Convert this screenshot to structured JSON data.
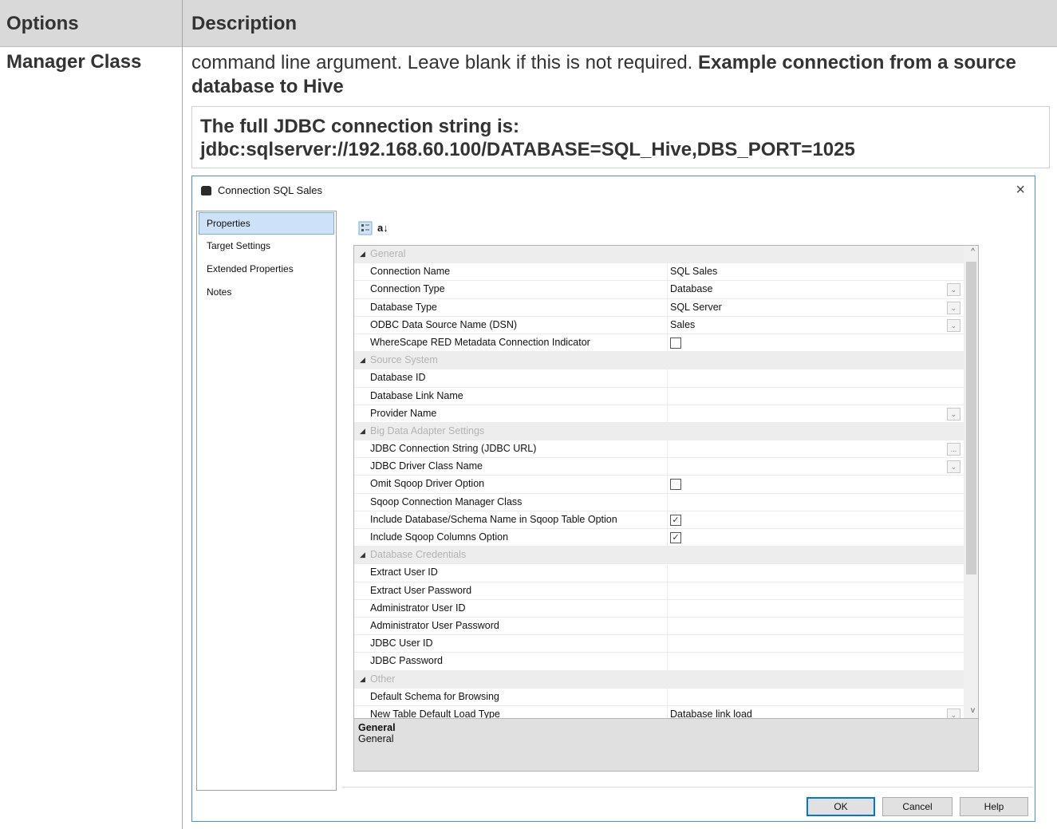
{
  "doc_table": {
    "col_options": "Options",
    "col_description": "Description",
    "row_label": "Manager Class",
    "desc_plain": "command line argument. Leave blank if this is not required. ",
    "desc_bold": "Example connection from a source database to Hive",
    "note_line1": "The full JDBC connection string is:",
    "note_line2": "jdbc:sqlserver://192.168.60.100/DATABASE=SQL_Hive,DBS_PORT=1025"
  },
  "dialog": {
    "title": "Connection SQL Sales",
    "close_icon": "close-icon",
    "nav": [
      "Properties",
      "Target Settings",
      "Extended Properties",
      "Notes"
    ],
    "selected_nav": "Properties",
    "toolbar_icons": [
      "categorized-icon",
      "sort-alpha-icon"
    ],
    "sort_glyph": "a↓",
    "properties": [
      {
        "type": "cat",
        "name": "General"
      },
      {
        "type": "prop",
        "name": "Connection Name",
        "value": "SQL Sales"
      },
      {
        "type": "prop",
        "name": "Connection Type",
        "value": "Database",
        "dropdown": true
      },
      {
        "type": "prop",
        "name": "Database Type",
        "value": "SQL Server",
        "dropdown": true
      },
      {
        "type": "prop",
        "name": "ODBC Data Source Name (DSN)",
        "value": "Sales",
        "dropdown": true
      },
      {
        "type": "prop",
        "name": "WhereScape RED Metadata Connection Indicator",
        "checkbox": false
      },
      {
        "type": "cat",
        "name": "Source System"
      },
      {
        "type": "prop",
        "name": "Database ID",
        "value": ""
      },
      {
        "type": "prop",
        "name": "Database Link Name",
        "value": ""
      },
      {
        "type": "prop",
        "name": "Provider Name",
        "value": "",
        "dropdown": true
      },
      {
        "type": "cat",
        "name": "Big Data Adapter Settings"
      },
      {
        "type": "prop",
        "name": "JDBC Connection String (JDBC URL)",
        "value": "",
        "ellipsis": true
      },
      {
        "type": "prop",
        "name": "JDBC Driver Class Name",
        "value": "",
        "dropdown": true
      },
      {
        "type": "prop",
        "name": "Omit Sqoop Driver Option",
        "checkbox": false
      },
      {
        "type": "prop",
        "name": "Sqoop Connection Manager Class",
        "value": ""
      },
      {
        "type": "prop",
        "name": "Include Database/Schema Name in Sqoop Table Option",
        "checkbox": true
      },
      {
        "type": "prop",
        "name": "Include Sqoop Columns Option",
        "checkbox": true
      },
      {
        "type": "cat",
        "name": "Database Credentials"
      },
      {
        "type": "prop",
        "name": "Extract User ID",
        "value": ""
      },
      {
        "type": "prop",
        "name": "Extract User Password",
        "value": ""
      },
      {
        "type": "prop",
        "name": "Administrator User ID",
        "value": ""
      },
      {
        "type": "prop",
        "name": "Administrator User Password",
        "value": ""
      },
      {
        "type": "prop",
        "name": "JDBC User ID",
        "value": ""
      },
      {
        "type": "prop",
        "name": "JDBC Password",
        "value": ""
      },
      {
        "type": "cat",
        "name": "Other"
      },
      {
        "type": "prop",
        "name": "Default Schema for Browsing",
        "value": ""
      },
      {
        "type": "prop",
        "name": "New Table Default Load Type",
        "value": "Database link load",
        "dropdown": true
      }
    ],
    "help_title": "General",
    "help_text": "General",
    "buttons": {
      "ok": "OK",
      "cancel": "Cancel",
      "help": "Help"
    },
    "checkmark": "✓",
    "ellipsis": "...",
    "dropdown_glyph": "⌄",
    "tri_glyph": "◢",
    "scroll_up": "^",
    "scroll_down": "v"
  }
}
